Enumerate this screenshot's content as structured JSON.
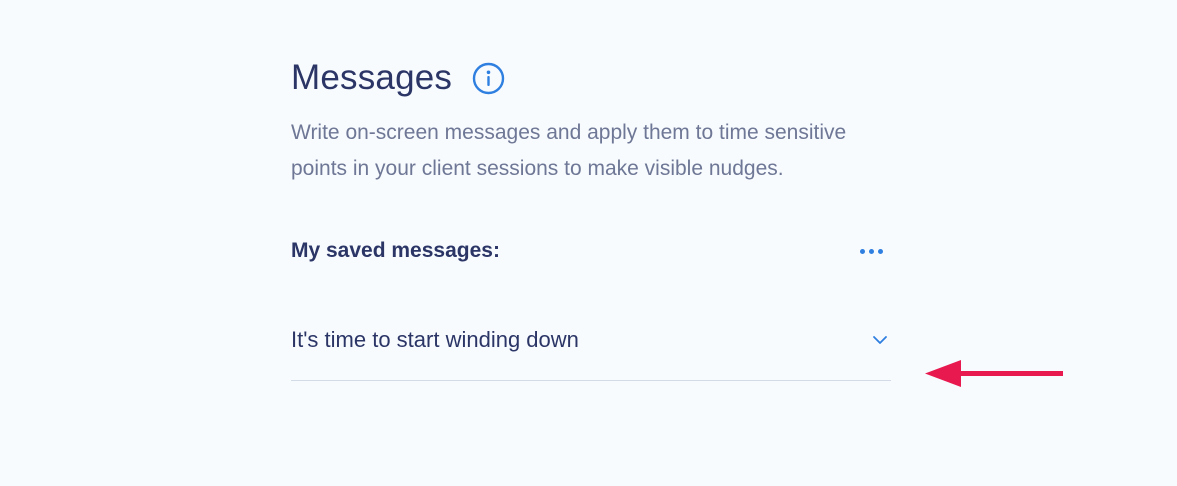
{
  "header": {
    "title": "Messages",
    "info_icon": "info-icon"
  },
  "description": "Write on-screen messages and apply them to time sensitive points in your client sessions to make visible nudges.",
  "saved": {
    "label": "My saved messages:",
    "more_icon": "more-horizontal-icon"
  },
  "messages": [
    {
      "text": "It's time to start winding down",
      "icon": "chevron-down-icon"
    }
  ],
  "colors": {
    "background": "#f7fbfe",
    "title": "#2b3566",
    "body_text": "#6e7795",
    "accent": "#2e7fe0",
    "annotation_arrow": "#e8194f",
    "divider": "#d3dce6"
  }
}
